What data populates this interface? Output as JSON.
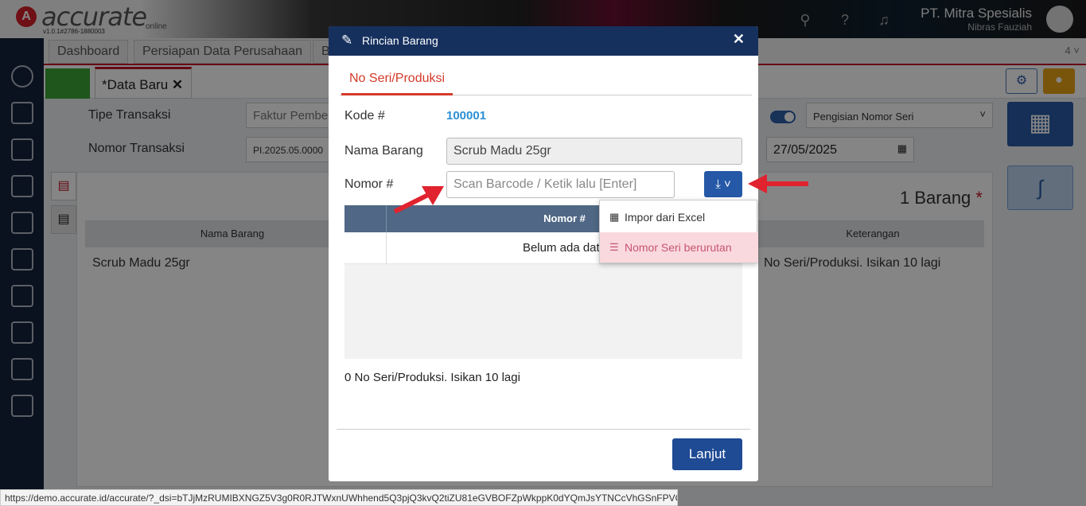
{
  "app": {
    "logo_letter": "A",
    "logo_text": "accurate",
    "logo_sub": "online",
    "version": "v1.0.1#2786-1880003",
    "company": "PT. Mitra Spesialis",
    "user": "Nibras Fauziah"
  },
  "tabs": {
    "items": [
      "Dashboard",
      "Persiapan Data Perusahaan",
      "B"
    ],
    "count": "4"
  },
  "doc_tab": {
    "label": "*Data Baru"
  },
  "form": {
    "tipe_label": "Tipe Transaksi",
    "tipe_value": "Faktur Pembe",
    "nomor_label": "Nomor Transaksi",
    "nomor_value": "PI.2025.05.0000",
    "serial_mode": "Pengisian Nomor Seri",
    "date": "27/05/2025",
    "barang_count": "1 Barang",
    "required_mark": "*"
  },
  "grid": {
    "col_nama": "Nama Barang",
    "col_keterangan": "Keterangan",
    "row_nama": "Scrub Madu 25gr",
    "row_keterangan": "No Seri/Produksi. Isikan 10 lagi"
  },
  "modal": {
    "title": "Rincian Barang",
    "tab": "No Seri/Produksi",
    "kode_label": "Kode #",
    "kode_value": "100001",
    "nama_label": "Nama Barang",
    "nama_value": "Scrub Madu 25gr",
    "nomor_label": "Nomor #",
    "nomor_placeholder": "Scan Barcode / Ketik lalu [Enter]",
    "table_header": "Nomor #",
    "empty_text": "Belum ada data",
    "count_text": "0 No Seri/Produksi. Isikan 10 lagi",
    "button": "Lanjut"
  },
  "dropdown": {
    "items": [
      "Impor dari Excel",
      "Nomor Seri berurutan"
    ]
  },
  "status_url": "https://demo.accurate.id/accurate/?_dsi=bTJjMzRUMIBXNGZ5V3g0R0RJTWxnUWhhend5Q3pjQ3kvQ2tiZU81eGVBOFZpWkppK0dYQmJsYTNCcVhGSnFPVQ==#",
  "colors": {
    "accent": "#c4162a",
    "modal_header": "#16305e",
    "primary": "#2558a7"
  }
}
